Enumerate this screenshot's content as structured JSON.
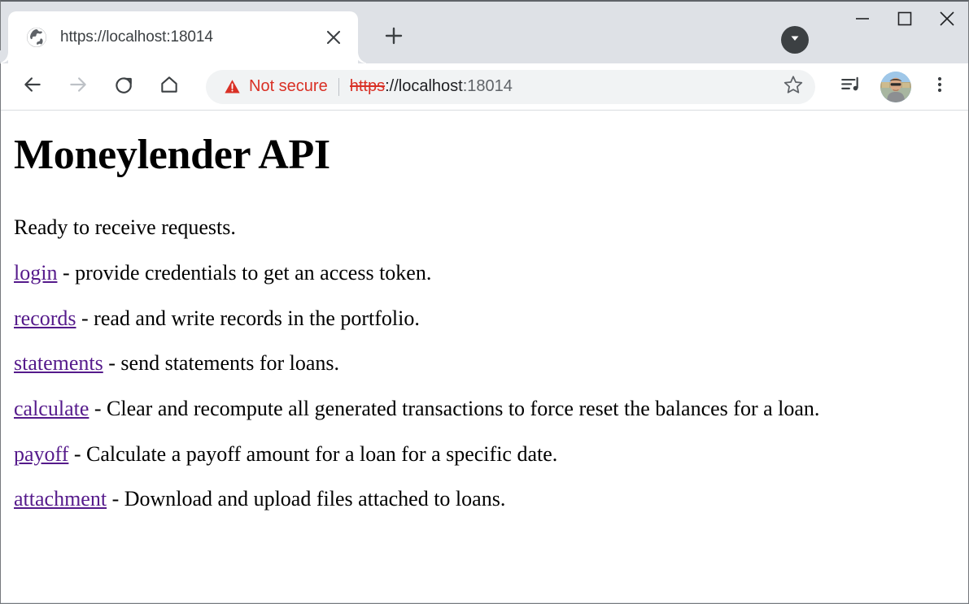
{
  "browser": {
    "tab": {
      "title": "https://localhost:18014",
      "favicon_icon": "globe-icon",
      "close_icon": "close-icon"
    },
    "new_tab_icon": "plus-icon",
    "tab_search_icon": "chevron-down-icon",
    "window_controls": {
      "minimize_icon": "minimize-icon",
      "maximize_icon": "maximize-icon",
      "close_icon": "close-icon"
    },
    "nav": {
      "back_icon": "back-arrow-icon",
      "forward_icon": "forward-arrow-icon",
      "reload_icon": "reload-icon",
      "home_icon": "home-icon"
    },
    "omnibox": {
      "warning_icon": "warning-triangle-icon",
      "security_label": "Not secure",
      "security_color": "#d93025",
      "url_scheme": "https",
      "url_host": "://localhost",
      "url_port": ":18014",
      "full_url": "https://localhost:18014"
    },
    "actions": {
      "bookmark_icon": "star-icon",
      "media_icon": "music-playlist-icon",
      "profile_icon": "avatar",
      "menu_icon": "three-dot-menu-icon"
    }
  },
  "page": {
    "title": "Moneylender API",
    "status": "Ready to receive requests.",
    "link_color": "#551a8b",
    "entries": [
      {
        "link": "login",
        "description": " - provide credentials to get an access token."
      },
      {
        "link": "records",
        "description": " - read and write records in the portfolio."
      },
      {
        "link": "statements",
        "description": " - send statements for loans."
      },
      {
        "link": "calculate",
        "description": " - Clear and recompute all generated transactions to force reset the balances for a loan."
      },
      {
        "link": "payoff",
        "description": " - Calculate a payoff amount for a loan for a specific date."
      },
      {
        "link": "attachment",
        "description": " - Download and upload files attached to loans."
      }
    ]
  }
}
